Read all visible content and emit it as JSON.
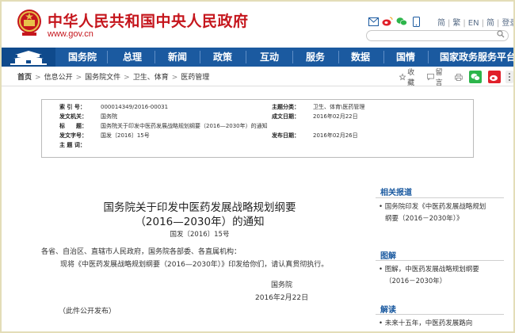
{
  "header": {
    "site_title": "中华人民共和国中央人民政府",
    "site_url": "www.gov.cn",
    "top_links": [
      "登录",
      "繁",
      "EN",
      "简",
      "登录"
    ],
    "lang_links": {
      "jian": "简",
      "fan": "繁",
      "en": "EN",
      "sep": "|",
      "login": "登录"
    }
  },
  "nav": {
    "items": [
      "国务院",
      "总理",
      "新闻",
      "政策",
      "互动",
      "服务",
      "数据",
      "国情",
      "国家政务服务平台"
    ]
  },
  "breadcrumb": {
    "items": [
      "首页",
      "信息公开",
      "国务院文件",
      "卫生、体育",
      "医药管理"
    ],
    "sep": ">"
  },
  "tools": {
    "favorite": "收藏",
    "comment": "留言"
  },
  "info": {
    "index_label": "索 引 号：",
    "index_value": "000014349/2016-00031",
    "category_label": "主题分类：",
    "category_value": "卫生、体育\\医药管理",
    "issuer_label": "发文机关：",
    "issuer_value": "国务院",
    "date_label": "成文日期：",
    "date_value": "2016年02月22日",
    "title_label": "标　　题：",
    "title_value": "国务院关于印发中医药发展战略规划纲要（2016—2030年）的通知",
    "docno_label": "发文字号：",
    "docno_value": "国发〔2016〕15号",
    "publish_label": "发布日期：",
    "publish_value": "2016年02月26日",
    "subject_label": "主 题 词：",
    "subject_value": ""
  },
  "article": {
    "title_line1": "国务院关于印发中医药发展战略规划纲要",
    "title_line2": "（2016—2030年）的通知",
    "doc_number": "国发〔2016〕15号",
    "salutation": "各省、自治区、直辖市人民政府，国务院各部委、各直属机构：",
    "body": "现将《中医药发展战略规划纲要（2016—2030年）》印发给你们，请认真贯彻执行。",
    "signature": "国务院",
    "date": "2016年2月22日",
    "note": "（此件公开发布）"
  },
  "sidebar": {
    "related_title": "相关报道",
    "related_line1": "国务院印发《中医药发展战略规划",
    "related_line2": "纲要（2016－2030年）》",
    "graphic_title": "图解",
    "graphic_line1": "图解，中医药发展战略规划纲要",
    "graphic_line2": "（2016－2030年）",
    "reading_title": "解读",
    "reading_line1": "未来十五年，中医药发展路向"
  },
  "colors": {
    "brand_red": "#c5161d",
    "nav_blue": "#1b5aa0",
    "frame": "#e3ddb8"
  }
}
